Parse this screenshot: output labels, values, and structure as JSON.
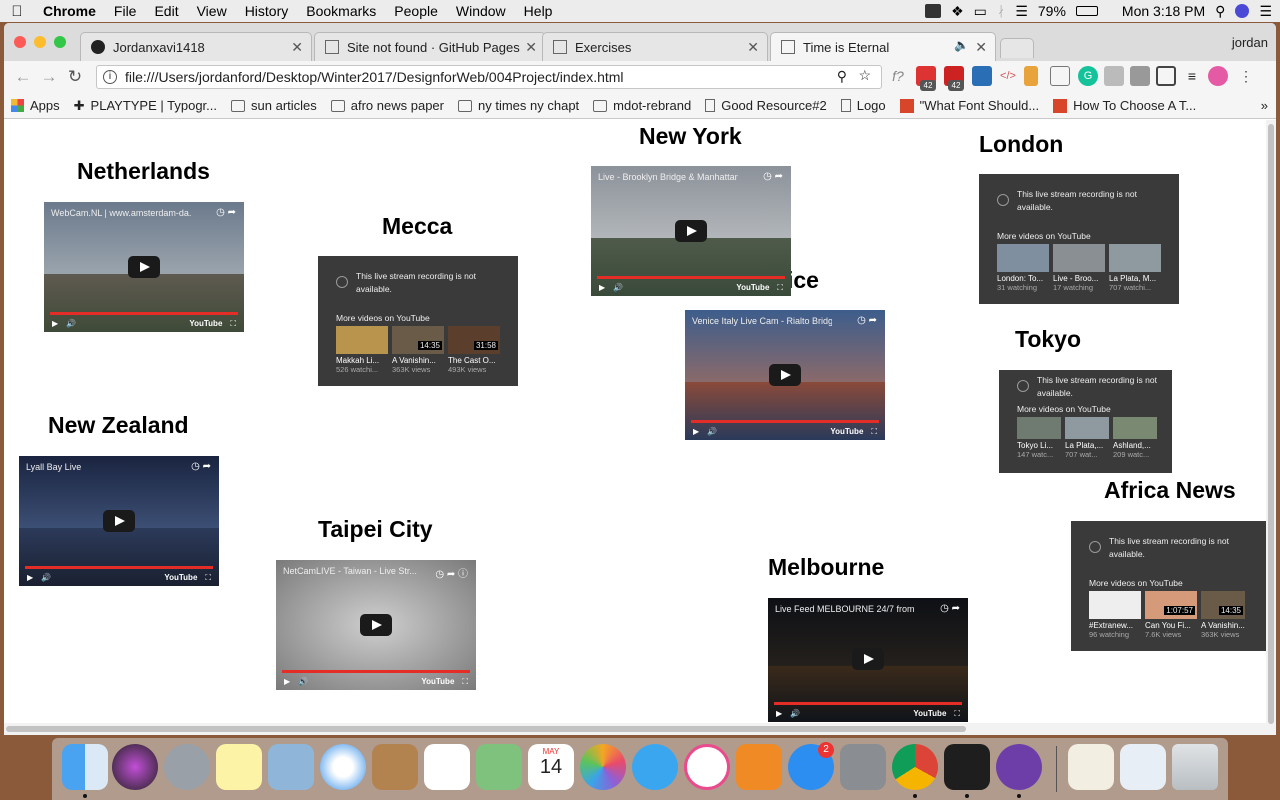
{
  "menubar": {
    "app": "Chrome",
    "items": [
      "File",
      "Edit",
      "View",
      "History",
      "Bookmarks",
      "People",
      "Window",
      "Help"
    ],
    "battery": "79%",
    "clock": "Mon 3:18 PM"
  },
  "tabs": [
    {
      "title": "Jordanxavi1418"
    },
    {
      "title": "Site not found · GitHub Pages"
    },
    {
      "title": "Exercises"
    },
    {
      "title": "Time is Eternal"
    }
  ],
  "profile_name": "jordan",
  "address": {
    "url": "file:///Users/jordanford/Desktop/Winter2017/DesignforWeb/004Project/index.html"
  },
  "extensions": {
    "badge_a": "42",
    "badge_b": "42"
  },
  "bookmarks": [
    "Apps",
    "PLAYTYPE | Typogr...",
    "sun articles",
    "afro news paper",
    "ny times ny chapt",
    "mdot-rebrand",
    "Good Resource#2",
    "Logo",
    "\"What Font Should...",
    "How To Choose A T..."
  ],
  "page": {
    "cities": {
      "netherlands": "Netherlands",
      "mecca": "Mecca",
      "new_york": "New York",
      "venice_fragment": "ice",
      "london": "London",
      "tokyo": "Tokyo",
      "new_zealand": "New Zealand",
      "taipei": "Taipei City",
      "melbourne": "Melbourne",
      "africa": "Africa News"
    },
    "videos": {
      "netherlands": "WebCam.NL | www.amsterdam-da...",
      "new_york": "Live - Brooklyn Bridge & Manhattan ...",
      "venice": "Venice Italy Live Cam - Rialto Bridge...",
      "new_zealand": "Lyall Bay Live",
      "taipei": "NetCamLIVE - Taiwan - Live Str...",
      "melbourne": "Live Feed MELBOURNE 24/7 from P..."
    },
    "youtube_label": "YouTube",
    "unavailable_msg": "This live stream recording is not available.",
    "more_videos": "More videos on YouTube",
    "mecca_thumbs": [
      {
        "title": "Makkah Li...",
        "meta": "526 watchi...",
        "duration": ""
      },
      {
        "title": "A Vanishin...",
        "meta": "363K views",
        "duration": "14:35"
      },
      {
        "title": "The Cast O...",
        "meta": "493K views",
        "duration": "31:58"
      }
    ],
    "london_thumbs": [
      {
        "title": "London: To...",
        "meta": "31 watching",
        "duration": ""
      },
      {
        "title": "Live - Broo...",
        "meta": "17 watching",
        "duration": ""
      },
      {
        "title": "La Plata, M...",
        "meta": "707 watchi...",
        "duration": ""
      }
    ],
    "tokyo_thumbs": [
      {
        "title": "Tokyo Li...",
        "meta": "147 watc...",
        "duration": ""
      },
      {
        "title": "La Plata,...",
        "meta": "707 wat...",
        "duration": ""
      },
      {
        "title": "Ashland,...",
        "meta": "209 watc...",
        "duration": ""
      }
    ],
    "africa_thumbs": [
      {
        "title": "#Extranew...",
        "meta": "96 watching",
        "duration": ""
      },
      {
        "title": "Can You Fi...",
        "meta": "7.6K views",
        "duration": "1:07:57"
      },
      {
        "title": "A Vanishin...",
        "meta": "363K views",
        "duration": "14:35"
      }
    ]
  },
  "dock": {
    "appstore_badge": "2",
    "calendar_month": "MAY",
    "calendar_day": "14"
  }
}
